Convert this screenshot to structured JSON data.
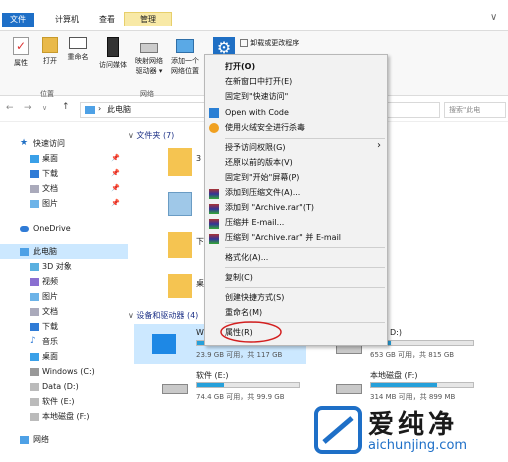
{
  "ribbon": {
    "tabs": [
      "文件",
      "计算机",
      "查看",
      "管理"
    ],
    "buttons": [
      "属性",
      "打开",
      "重命名",
      "访问媒体",
      "映射网络驱动器",
      "添加一个网络位置",
      "打开设置"
    ],
    "map_drive": [
      "映射网络",
      "驱动器 ▾"
    ],
    "add_location": [
      "添加一个",
      "网络位置"
    ],
    "small_items": [
      "卸载或更改程序"
    ],
    "groups": [
      "位置",
      "网络"
    ]
  },
  "address": {
    "nav": [
      "←",
      "→",
      "∨",
      "↑"
    ],
    "path": "此电脑",
    "search_placeholder": "搜索\"此电"
  },
  "nav_pane": {
    "items": [
      "快速访问",
      "桌面",
      "下载",
      "文档",
      "图片",
      "OneDrive",
      "此电脑",
      "3D 对象",
      "视频",
      "图片",
      "文档",
      "下载",
      "音乐",
      "桌面",
      "Windows (C:)",
      "Data (D:)",
      "软件 (E:)",
      "本地磁盘 (F:)",
      "网络"
    ]
  },
  "content": {
    "folders_header": "文件夹 (7)",
    "drives_header": "设备和驱动器 (4)",
    "folder_labels": [
      "3",
      "",
      "下",
      "桌"
    ],
    "drives": [
      {
        "name": "W",
        "space": "23.9 GB 可用，共 117 GB",
        "fill": 0.8
      },
      {
        "name": "D:)",
        "space": "653 GB 可用，共 815 GB",
        "fill": 0.2
      },
      {
        "name": "软件 (E:)",
        "space": "74.4 GB 可用，共 99.9 GB",
        "fill": 0.26
      },
      {
        "name": "本地磁盘 (F:)",
        "space": "314 MB 可用，共 899 MB",
        "fill": 0.65
      }
    ]
  },
  "context_menu": {
    "items": [
      "打开(O)",
      "在新窗口中打开(E)",
      "固定到\"快速访问\"",
      "Open with Code",
      "使用火绒安全进行杀毒",
      "授予访问权限(G)",
      "还原以前的版本(V)",
      "固定到\"开始\"屏幕(P)",
      "添加到压缩文件(A)...",
      "添加到 \"Archive.rar\"(T)",
      "压缩并 E-mail...",
      "压缩到 \"Archive.rar\" 并 E-mail",
      "格式化(A)...",
      "复制(C)",
      "创建快捷方式(S)",
      "重命名(M)",
      "属性(R)"
    ],
    "submenu_arrow": "›"
  },
  "watermark": {
    "brand": "爱纯净",
    "url": "aichunjing.com"
  }
}
